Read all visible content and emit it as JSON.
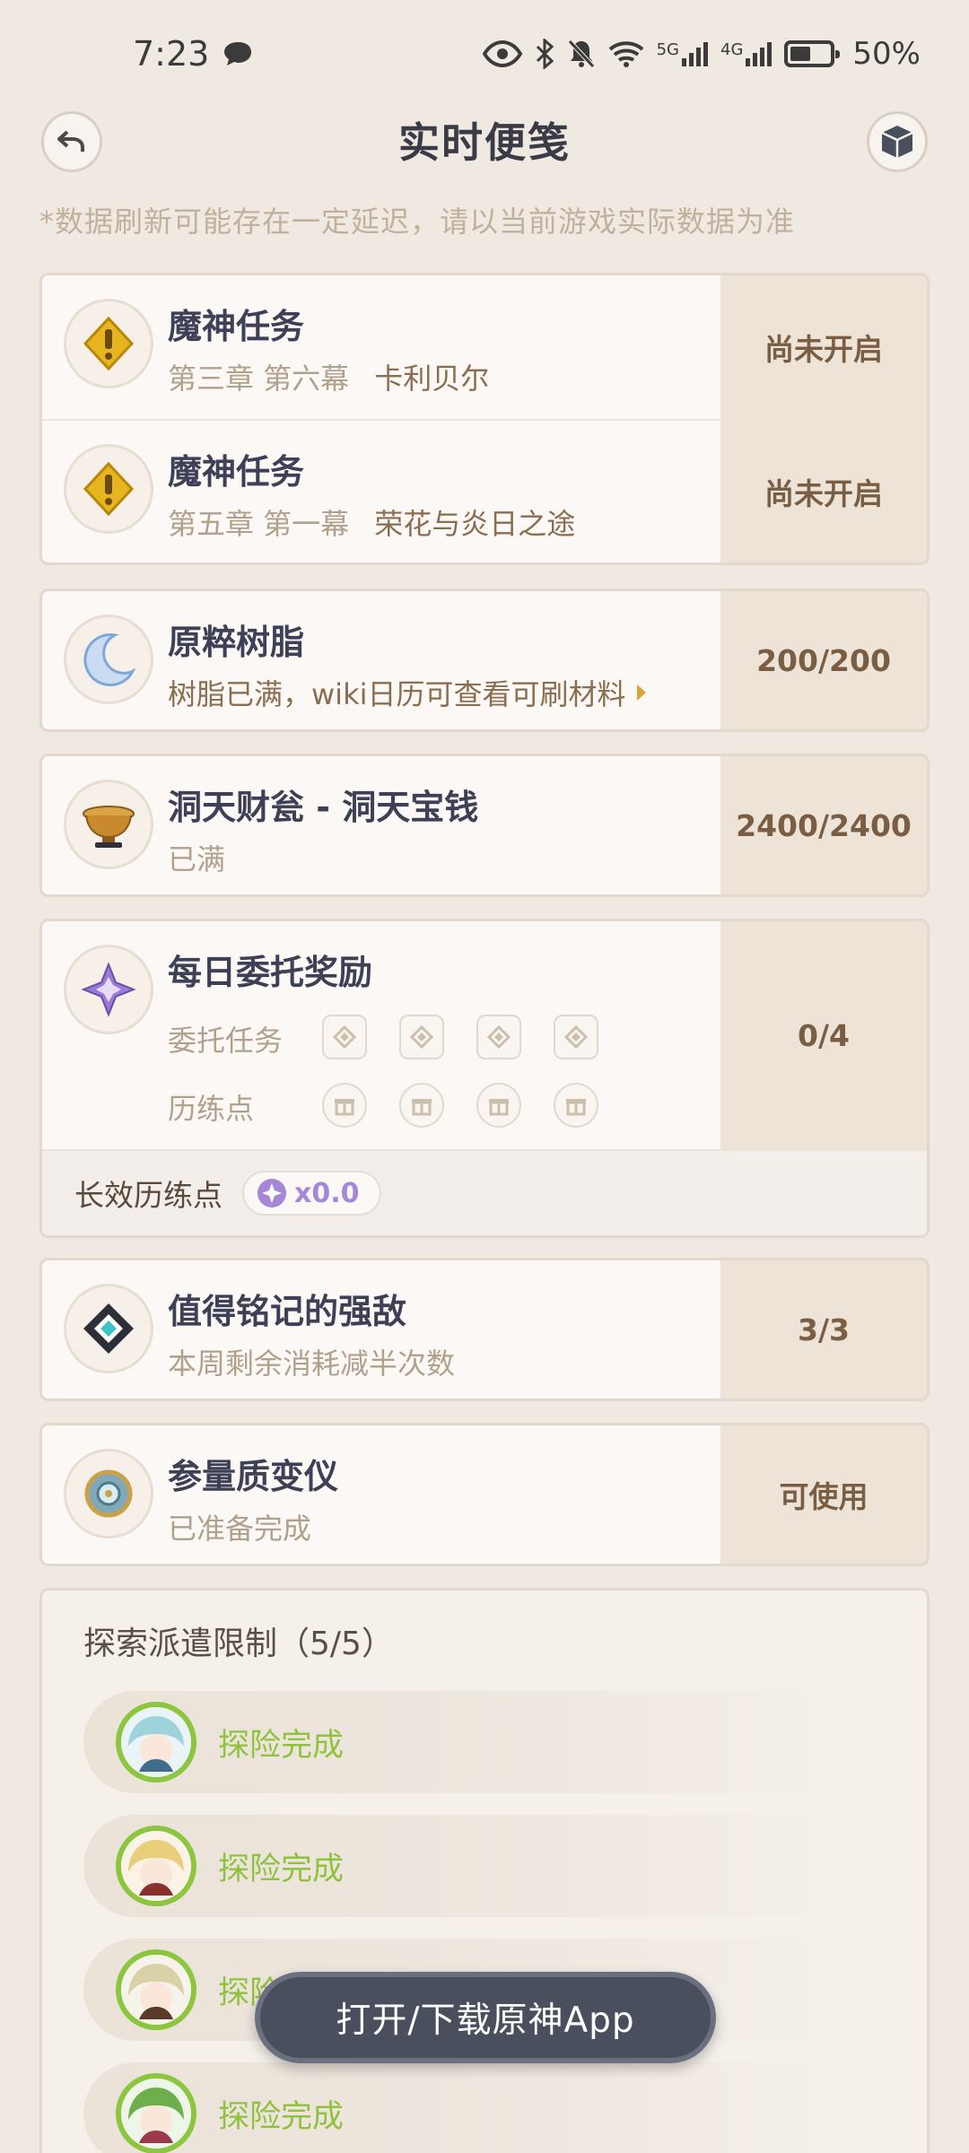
{
  "status_bar": {
    "time": "7:23",
    "battery": "50%",
    "net1": "5G",
    "net2": "4G"
  },
  "header": {
    "title": "实时便笺"
  },
  "notice": "*数据刷新可能存在一定延迟，请以当前游戏实际数据为准",
  "archon_quests": [
    {
      "title": "魔神任务",
      "chapter": "第三章 第六幕",
      "name": "卡利贝尔",
      "status": "尚未开启"
    },
    {
      "title": "魔神任务",
      "chapter": "第五章 第一幕",
      "name": "荣花与炎日之途",
      "status": "尚未开启"
    }
  ],
  "resin": {
    "title": "原粹树脂",
    "subtitle": "树脂已满，wiki日历可查看可刷材料",
    "value": "200/200"
  },
  "teapot": {
    "title": "洞天财瓮 - 洞天宝钱",
    "subtitle": "已满",
    "value": "2400/2400"
  },
  "commissions": {
    "title": "每日委托奖励",
    "task_label": "委托任务",
    "points_label": "历练点",
    "value": "0/4",
    "long_term_label": "长效历练点",
    "long_term_value": "x0.0"
  },
  "weekly_boss": {
    "title": "值得铭记的强敌",
    "subtitle": "本周剩余消耗减半次数",
    "value": "3/3"
  },
  "transformer": {
    "title": "参量质变仪",
    "subtitle": "已准备完成",
    "value": "可使用"
  },
  "expeditions": {
    "title": "探索派遣限制（5/5）",
    "items": [
      {
        "status": "探险完成"
      },
      {
        "status": "探险完成"
      },
      {
        "status": "探险完成"
      },
      {
        "status": "探险完成"
      }
    ]
  },
  "floating_button": "打开/下载原神App",
  "colors": {
    "background": "#efe9e2",
    "side_panel": "#ede3d7",
    "accent_green": "#8fc23f",
    "accent_purple": "#a487d7"
  }
}
